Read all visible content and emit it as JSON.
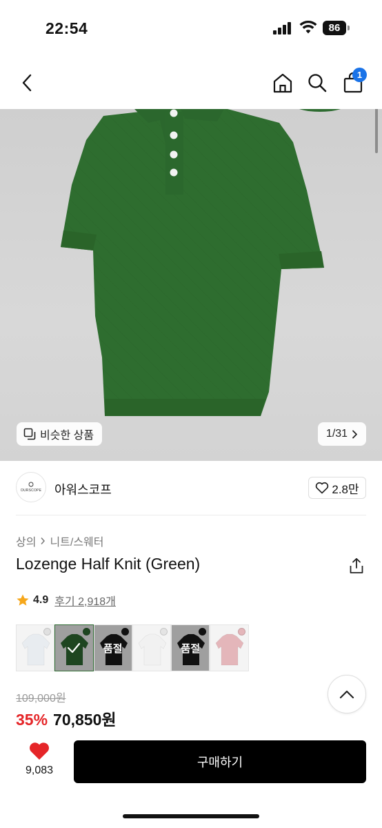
{
  "status_bar": {
    "time": "22:54",
    "battery": "86"
  },
  "nav": {
    "cart_count": "1"
  },
  "hero": {
    "similar_label": "비슷한 상품",
    "page_indicator": "1/31"
  },
  "brand": {
    "name": "아워스코프",
    "logo_text": "OURSCOPE",
    "likes": "2.8만"
  },
  "breadcrumb": [
    "상의",
    "니트/스웨터"
  ],
  "product": {
    "title": "Lozenge Half Knit (Green)",
    "rating": "4.9",
    "reviews": "후기 2,918개",
    "original_price": "109,000원",
    "discount": "35%",
    "sale_price": "70,850원"
  },
  "swatches": [
    {
      "color": "#e8ecf0",
      "dot": "#e0e0e0",
      "overlay": ""
    },
    {
      "color": "#2e6b32",
      "dot": "#2e6b32",
      "overlay": "check"
    },
    {
      "color": "#1a1a1a",
      "dot": "#1a1a1a",
      "overlay": "품절"
    },
    {
      "color": "#f1f1f1",
      "dot": "#e4e4e4",
      "overlay": ""
    },
    {
      "color": "#1b1b1b",
      "dot": "#1b1b1b",
      "overlay": "품절"
    },
    {
      "color": "#e4b6ba",
      "dot": "#e4b6ba",
      "overlay": ""
    }
  ],
  "bottom": {
    "wish_count": "9,083",
    "buy_label": "구매하기"
  },
  "colors": {
    "accent_red": "#e52528",
    "badge_blue": "#1a73e8",
    "product_green": "#2d6b30"
  }
}
